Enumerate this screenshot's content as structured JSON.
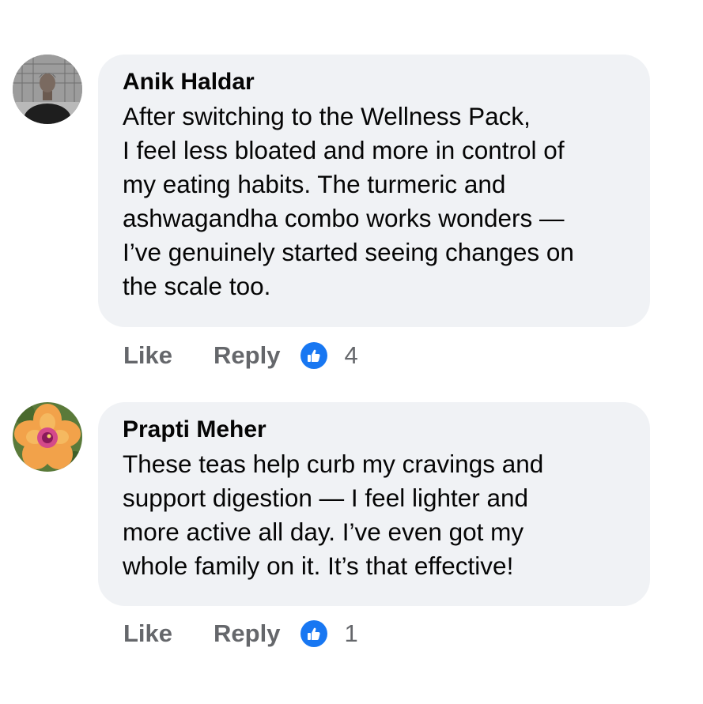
{
  "colors": {
    "bubble_bg": "#f0f2f5",
    "action_text": "#65676b",
    "reaction_blue": "#1877f2"
  },
  "comments": [
    {
      "author": "Anik Haldar",
      "avatar_icon": "person-photo",
      "lines": [
        "After switching to the Wellness Pack,",
        "I feel less bloated and more in control of",
        "my eating habits. The turmeric and",
        "ashwagandha combo works wonders —",
        "I’ve genuinely started seeing changes on",
        "the scale too."
      ],
      "like_label": "Like",
      "reply_label": "Reply",
      "reaction_icon": "thumbs-up-icon",
      "reaction_count": "4"
    },
    {
      "author": "Prapti Meher",
      "avatar_icon": "flower-photo",
      "lines": [
        "These teas help curb my cravings and",
        "support digestion — I feel lighter and",
        "more active all day. I’ve even got my",
        "whole family on it. It’s that effective!"
      ],
      "like_label": "Like",
      "reply_label": "Reply",
      "reaction_icon": "thumbs-up-icon",
      "reaction_count": "1"
    }
  ]
}
